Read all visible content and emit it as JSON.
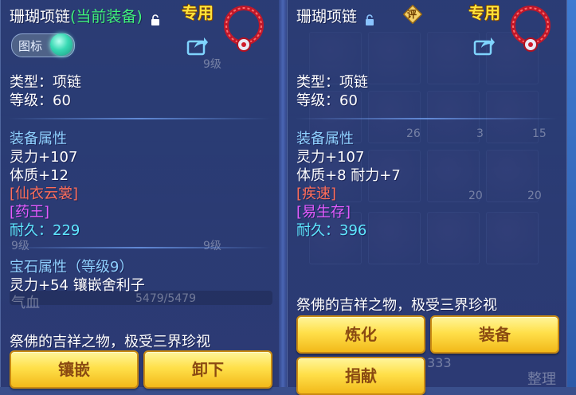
{
  "left": {
    "title_name": "珊瑚项链",
    "title_status": "(当前装备)",
    "exclusive": "专用",
    "icon_toggle_label": "图标",
    "type": "类型：项链",
    "level": "等级：60",
    "attr_header": "装备属性",
    "attrs": [
      "灵力+107",
      "体质+12"
    ],
    "special_red": "[仙衣云裳]",
    "special_purple": "[药王]",
    "durability_label": "耐久：",
    "durability_value": "229",
    "gem_header": "宝石属性（等级9）",
    "gem_attr": "灵力+54 镶嵌舍利子",
    "description": "祭佛的吉祥之物，极受三界珍视",
    "buttons": [
      "镶嵌",
      "卸下"
    ],
    "bg_texts": {
      "level_badge": "9级",
      "hp_label": "气血",
      "hp_value": "5479/5479"
    }
  },
  "right": {
    "title_name": "珊瑚项链",
    "rate_icon": "评",
    "exclusive": "专用",
    "type": "类型：项链",
    "level": "等级：60",
    "attr_header": "装备属性",
    "attrs": [
      "灵力+107",
      "体质+8 耐力+7"
    ],
    "special_red": "[疾速]",
    "special_purple": "[易生存]",
    "durability_label": "耐久：",
    "durability_value": "396",
    "description": "祭佛的吉祥之物，极受三界珍视",
    "buttons": [
      "炼化",
      "装备",
      "捐献"
    ],
    "bg_texts": {
      "counts": [
        "26",
        "3",
        "15",
        "20",
        "20"
      ],
      "page_count": "333",
      "sort": "整理"
    }
  },
  "colors": {
    "equipped_green": "#3ff27a",
    "exclusive_gold": "#ffe23a",
    "section_blue": "#8fd1ff",
    "special_red": "#ff6e5a",
    "special_purple": "#e45cff",
    "durability_cyan": "#5fe8ff",
    "button_gold": "#ffe04a"
  },
  "icons": {
    "lock": "lock-icon",
    "share": "share-icon",
    "necklace": "coral-necklace-icon",
    "rate": "rate-badge-icon"
  }
}
